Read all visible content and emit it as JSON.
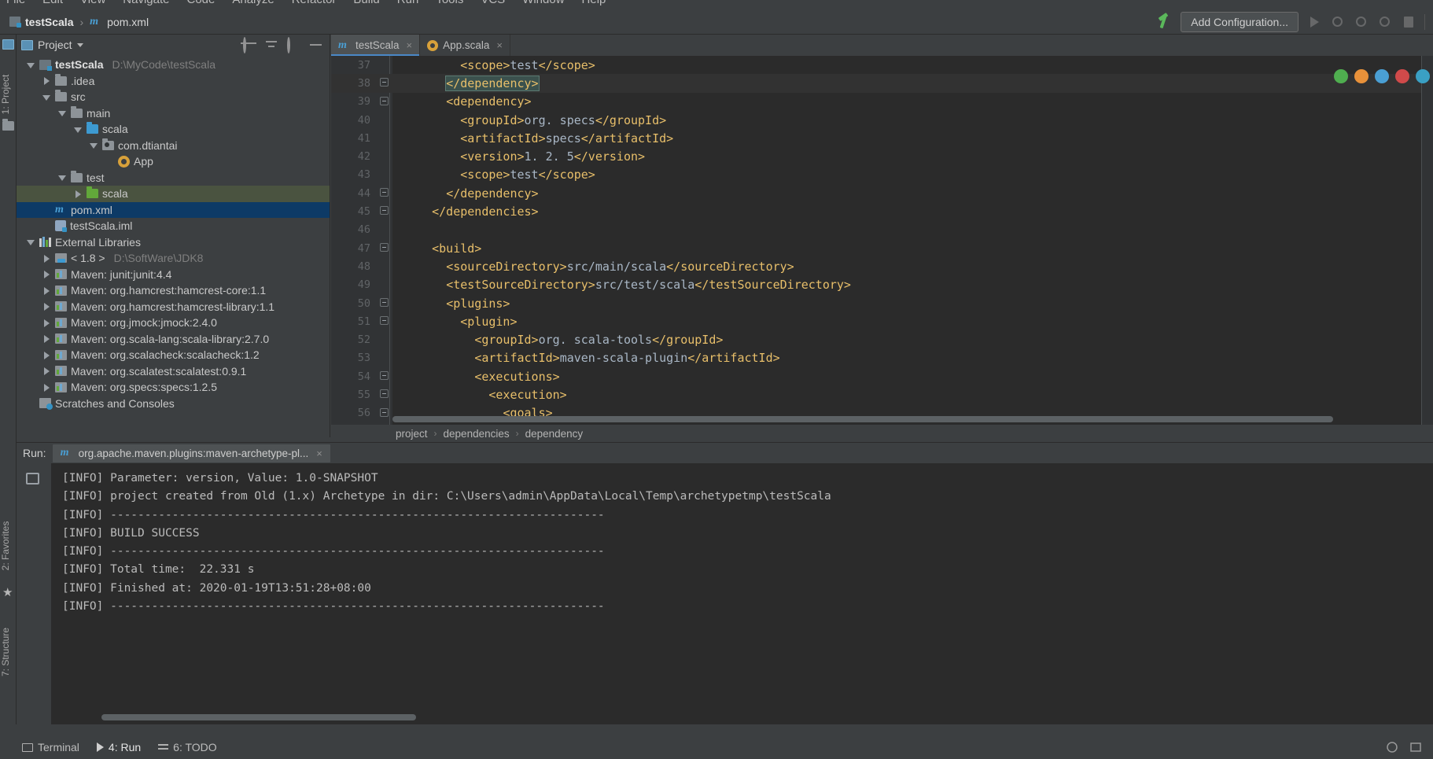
{
  "menu": {
    "items": [
      "File",
      "Edit",
      "View",
      "Navigate",
      "Code",
      "Analyze",
      "Refactor",
      "Build",
      "Run",
      "Tools",
      "VCS",
      "Window",
      "Help"
    ]
  },
  "navbar": {
    "crumbs": [
      {
        "label": "testScala",
        "icon": "module-icon",
        "bold": true
      },
      {
        "label": "pom.xml",
        "icon": "maven-m-icon",
        "bold": false
      }
    ],
    "separator": "›",
    "hammer_icon": "build-hammer-icon",
    "add_configuration": "Add Configuration...",
    "run_icon": "run-icon",
    "debug_icon": "debug-icon",
    "run_coverage_icon": "run-with-coverage-icon",
    "profile_icon": "profile-icon",
    "stop_icon": "stop-icon"
  },
  "browsers": [
    {
      "name": "chrome-browser-icon",
      "color": "#4fae4f"
    },
    {
      "name": "firefox-browser-icon",
      "color": "#e8913a"
    },
    {
      "name": "safari-browser-icon",
      "color": "#4a9fd4"
    },
    {
      "name": "opera-browser-icon",
      "color": "#d04a4a"
    },
    {
      "name": "edge-browser-icon",
      "color": "#3aa0c4"
    }
  ],
  "rail": {
    "project_label": "1: Project",
    "favorites_label": "2: Favorites",
    "structure_label": "7: Structure"
  },
  "project_pane": {
    "title": "Project",
    "actions": [
      "locate-icon",
      "collapse-all-icon",
      "settings-gear-icon",
      "hide-icon"
    ],
    "tree": [
      {
        "indent": 0,
        "arrow": "down",
        "icon": "module-icon",
        "label": "testScala",
        "bold": true,
        "sub": "D:\\MyCode\\testScala",
        "state": "none"
      },
      {
        "indent": 1,
        "arrow": "right",
        "icon": "folder-icon",
        "label": ".idea",
        "bold": false,
        "sub": "",
        "state": "none"
      },
      {
        "indent": 1,
        "arrow": "down",
        "icon": "folder-icon",
        "label": "src",
        "bold": false,
        "sub": "",
        "state": "none"
      },
      {
        "indent": 2,
        "arrow": "down",
        "icon": "folder-icon",
        "label": "main",
        "bold": false,
        "sub": "",
        "state": "none"
      },
      {
        "indent": 3,
        "arrow": "down",
        "icon": "source-folder-icon",
        "label": "scala",
        "bold": false,
        "sub": "",
        "state": "none"
      },
      {
        "indent": 4,
        "arrow": "down",
        "icon": "package-icon",
        "label": "com.dtiantai",
        "bold": false,
        "sub": "",
        "state": "none"
      },
      {
        "indent": 5,
        "arrow": "none",
        "icon": "scala-object-icon",
        "label": "App",
        "bold": false,
        "sub": "",
        "state": "none"
      },
      {
        "indent": 2,
        "arrow": "down",
        "icon": "folder-icon",
        "label": "test",
        "bold": false,
        "sub": "",
        "state": "none"
      },
      {
        "indent": 3,
        "arrow": "right",
        "icon": "test-folder-icon",
        "label": "scala",
        "bold": false,
        "sub": "",
        "state": "highlight"
      },
      {
        "indent": 1,
        "arrow": "none",
        "icon": "maven-m-icon",
        "label": "pom.xml",
        "bold": false,
        "sub": "",
        "state": "selected"
      },
      {
        "indent": 1,
        "arrow": "none",
        "icon": "iml-file-icon",
        "label": "testScala.iml",
        "bold": false,
        "sub": "",
        "state": "none"
      },
      {
        "indent": 0,
        "arrow": "down",
        "icon": "libraries-icon",
        "label": "External Libraries",
        "bold": false,
        "sub": "",
        "state": "none"
      },
      {
        "indent": 1,
        "arrow": "right",
        "icon": "jdk-icon",
        "label": "< 1.8 >",
        "bold": false,
        "sub": "D:\\SoftWare\\JDK8",
        "state": "none"
      },
      {
        "indent": 1,
        "arrow": "right",
        "icon": "maven-lib-icon",
        "label": "Maven: junit:junit:4.4",
        "bold": false,
        "sub": "",
        "state": "none"
      },
      {
        "indent": 1,
        "arrow": "right",
        "icon": "maven-lib-icon",
        "label": "Maven: org.hamcrest:hamcrest-core:1.1",
        "bold": false,
        "sub": "",
        "state": "none"
      },
      {
        "indent": 1,
        "arrow": "right",
        "icon": "maven-lib-icon",
        "label": "Maven: org.hamcrest:hamcrest-library:1.1",
        "bold": false,
        "sub": "",
        "state": "none"
      },
      {
        "indent": 1,
        "arrow": "right",
        "icon": "maven-lib-icon",
        "label": "Maven: org.jmock:jmock:2.4.0",
        "bold": false,
        "sub": "",
        "state": "none"
      },
      {
        "indent": 1,
        "arrow": "right",
        "icon": "maven-lib-icon",
        "label": "Maven: org.scala-lang:scala-library:2.7.0",
        "bold": false,
        "sub": "",
        "state": "none"
      },
      {
        "indent": 1,
        "arrow": "right",
        "icon": "maven-lib-icon",
        "label": "Maven: org.scalacheck:scalacheck:1.2",
        "bold": false,
        "sub": "",
        "state": "none"
      },
      {
        "indent": 1,
        "arrow": "right",
        "icon": "maven-lib-icon",
        "label": "Maven: org.scalatest:scalatest:0.9.1",
        "bold": false,
        "sub": "",
        "state": "none"
      },
      {
        "indent": 1,
        "arrow": "right",
        "icon": "maven-lib-icon",
        "label": "Maven: org.specs:specs:1.2.5",
        "bold": false,
        "sub": "",
        "state": "none"
      },
      {
        "indent": 0,
        "arrow": "none",
        "icon": "scratches-icon",
        "label": "Scratches and Consoles",
        "bold": false,
        "sub": "",
        "state": "none"
      }
    ]
  },
  "editor": {
    "tabs": [
      {
        "label": "testScala",
        "icon": "maven-m-icon",
        "active": true,
        "close": "×"
      },
      {
        "label": "App.scala",
        "icon": "scala-object-icon",
        "active": false,
        "close": "×"
      }
    ],
    "lines": [
      {
        "num": "37",
        "indent": 4,
        "fold": "none",
        "text": "<scope>test</scope>",
        "state": "none"
      },
      {
        "num": "38",
        "indent": 3,
        "fold": "end",
        "text": "</dependency>",
        "state": "caret"
      },
      {
        "num": "39",
        "indent": 3,
        "fold": "start",
        "text": "<dependency>",
        "state": "none"
      },
      {
        "num": "40",
        "indent": 4,
        "fold": "none",
        "text": "<groupId>org. specs</groupId>",
        "state": "none"
      },
      {
        "num": "41",
        "indent": 4,
        "fold": "none",
        "text": "<artifactId>specs</artifactId>",
        "state": "none"
      },
      {
        "num": "42",
        "indent": 4,
        "fold": "none",
        "text": "<version>1. 2. 5</version>",
        "state": "none"
      },
      {
        "num": "43",
        "indent": 4,
        "fold": "none",
        "text": "<scope>test</scope>",
        "state": "none"
      },
      {
        "num": "44",
        "indent": 3,
        "fold": "end",
        "text": "</dependency>",
        "state": "none"
      },
      {
        "num": "45",
        "indent": 2,
        "fold": "end",
        "text": "</dependencies>",
        "state": "none"
      },
      {
        "num": "46",
        "indent": 0,
        "fold": "none",
        "text": "",
        "state": "none"
      },
      {
        "num": "47",
        "indent": 2,
        "fold": "start",
        "text": "<build>",
        "state": "none"
      },
      {
        "num": "48",
        "indent": 3,
        "fold": "none",
        "text": "<sourceDirectory>src/main/scala</sourceDirectory>",
        "state": "none"
      },
      {
        "num": "49",
        "indent": 3,
        "fold": "none",
        "text": "<testSourceDirectory>src/test/scala</testSourceDirectory>",
        "state": "none"
      },
      {
        "num": "50",
        "indent": 3,
        "fold": "start",
        "text": "<plugins>",
        "state": "none"
      },
      {
        "num": "51",
        "indent": 4,
        "fold": "start",
        "text": "<plugin>",
        "state": "none"
      },
      {
        "num": "52",
        "indent": 5,
        "fold": "none",
        "text": "<groupId>org. scala-tools</groupId>",
        "state": "none"
      },
      {
        "num": "53",
        "indent": 5,
        "fold": "none",
        "text": "<artifactId>maven-scala-plugin</artifactId>",
        "state": "none"
      },
      {
        "num": "54",
        "indent": 5,
        "fold": "start",
        "text": "<executions>",
        "state": "none"
      },
      {
        "num": "55",
        "indent": 6,
        "fold": "start",
        "text": "<execution>",
        "state": "none"
      },
      {
        "num": "56",
        "indent": 7,
        "fold": "start",
        "text": "<goals>",
        "state": "none"
      }
    ]
  },
  "breadcrumb": {
    "items": [
      "project",
      "dependencies",
      "dependency"
    ],
    "separator": "›"
  },
  "run_pane": {
    "label": "Run:",
    "tab_title": "org.apache.maven.plugins:maven-archetype-pl...",
    "tab_icon": "maven-m-icon",
    "tab_close": "×",
    "side_icons": [
      "rerun-icon"
    ],
    "console_lines": [
      "[INFO] Parameter: version, Value: 1.0-SNAPSHOT",
      "[INFO] project created from Old (1.x) Archetype in dir: C:\\Users\\admin\\AppData\\Local\\Temp\\archetypetmp\\testScala",
      "[INFO] ------------------------------------------------------------------------",
      "[INFO] BUILD SUCCESS",
      "[INFO] ------------------------------------------------------------------------",
      "[INFO] Total time:  22.331 s",
      "[INFO] Finished at: 2020-01-19T13:51:28+08:00",
      "[INFO] ------------------------------------------------------------------------"
    ]
  },
  "statusbar": {
    "items": [
      {
        "label": "Terminal",
        "icon": "terminal-icon",
        "active": false
      },
      {
        "label": "4: Run",
        "icon": "run-icon",
        "active": true
      },
      {
        "label": "6: TODO",
        "icon": "todo-icon",
        "active": false
      }
    ],
    "right_icons": [
      "event-log-icon",
      "layout-icon"
    ]
  },
  "colors": {
    "background": "#3c3f41",
    "editor_background": "#2b2b2b",
    "accent": "#4a88c7",
    "selection": "#0d3a66",
    "xml_tag": "#e8bf6a",
    "xml_text": "#a9b7c6",
    "test_folder_highlight": "#4a5340"
  }
}
